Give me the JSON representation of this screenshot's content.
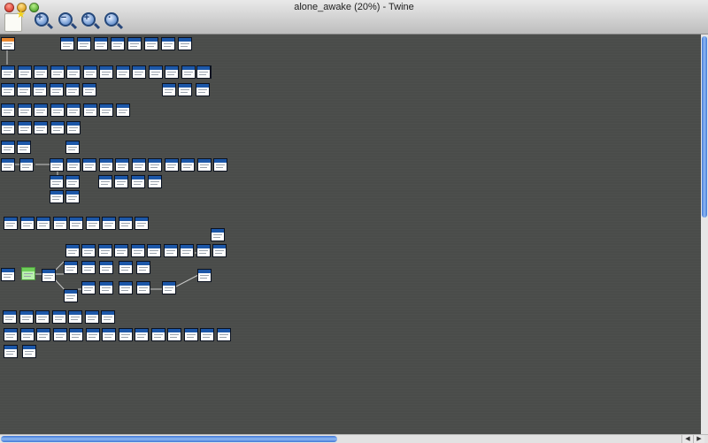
{
  "window": {
    "title": "alone_awake (20%) - Twine"
  },
  "toolbar": {
    "new_passage_icon": "new-passage-icon",
    "zoom_in_icon": "zoom-in-icon",
    "zoom_out_icon": "zoom-out-icon",
    "zoom_in_large_icon": "zoom-in-large-icon",
    "zoom_fit_icon": "zoom-fit-icon"
  },
  "colors": {
    "canvas_bg": "#4a4c4a",
    "passage_header": "#1c57a8",
    "start_header": "#e8872f",
    "selected_bg": "#b9f0ad",
    "scroll_thumb": "#3f78d8"
  }
}
